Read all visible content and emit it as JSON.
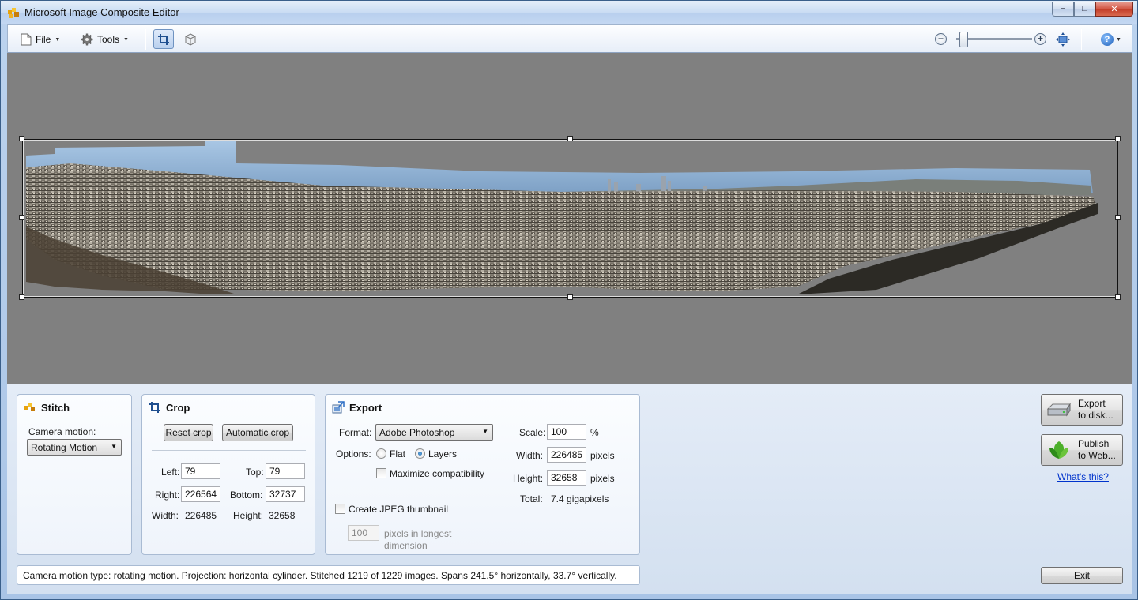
{
  "window": {
    "title": "Microsoft Image Composite Editor",
    "caption_minimize": "–",
    "caption_maximize": "□",
    "caption_close": "✕"
  },
  "toolbar": {
    "file_label": "File",
    "tools_label": "Tools",
    "zoom_out_glyph": "−",
    "zoom_in_glyph": "+",
    "help_glyph": "?",
    "zoom_level": 0.05
  },
  "stitch": {
    "title": "Stitch",
    "camera_motion_label": "Camera motion:",
    "camera_motion_value": "Rotating Motion"
  },
  "crop": {
    "title": "Crop",
    "reset_label": "Reset crop",
    "auto_label": "Automatic crop",
    "left_label": "Left:",
    "left_value": "79",
    "top_label": "Top:",
    "top_value": "79",
    "right_label": "Right:",
    "right_value": "226564",
    "bottom_label": "Bottom:",
    "bottom_value": "32737",
    "width_label": "Width:",
    "width_value": "226485",
    "height_label": "Height:",
    "height_value": "32658"
  },
  "export": {
    "title": "Export",
    "format_label": "Format:",
    "format_value": "Adobe Photoshop",
    "options_label": "Options:",
    "flat_label": "Flat",
    "layers_label": "Layers",
    "maximize_label": "Maximize compatibility",
    "jpeg_label": "Create JPEG thumbnail",
    "thumb_value": "100",
    "thumb_note_1": "pixels in longest",
    "thumb_note_2": "dimension",
    "scale_label": "Scale:",
    "scale_value": "100",
    "scale_unit": "%",
    "width_label": "Width:",
    "width_value": "226485",
    "width_unit": "pixels",
    "height_label": "Height:",
    "height_value": "32658",
    "height_unit": "pixels",
    "total_label": "Total:",
    "total_value": "7.4 gigapixels"
  },
  "actions": {
    "export_disk_1": "Export",
    "export_disk_2": "to disk...",
    "publish_1": "Publish",
    "publish_2": "to Web...",
    "whats_this": "What's this?",
    "exit_label": "Exit"
  },
  "status": {
    "text": "Camera motion type: rotating motion. Projection: horizontal cylinder. Stitched 1219 of 1229 images. Spans 241.5° horizontally, 33.7° vertically."
  },
  "colors": {
    "canvas_bg": "#808080",
    "sky": "#8fb4d6",
    "city": "#6f6a62",
    "link": "#0033cc"
  }
}
